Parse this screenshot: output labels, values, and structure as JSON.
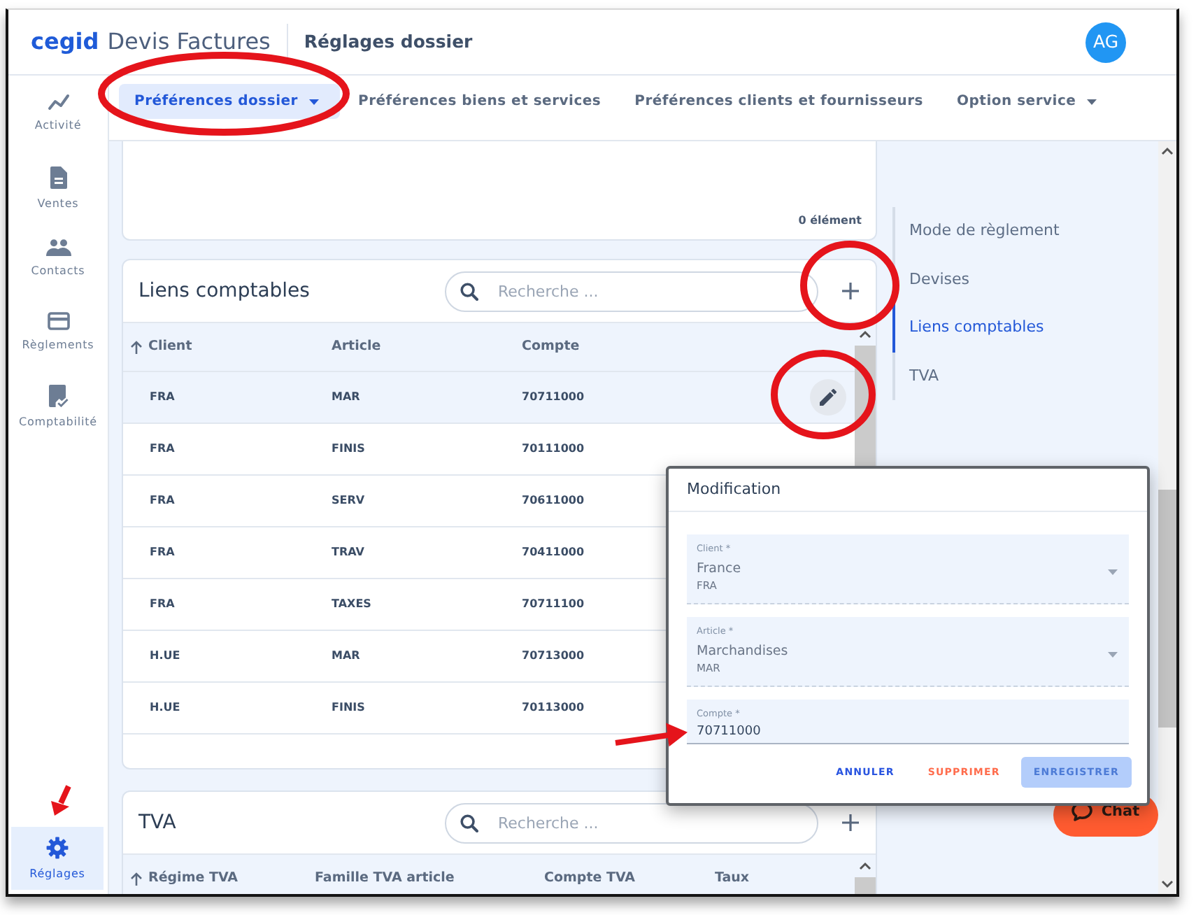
{
  "header": {
    "brand": "cegid",
    "product": "Devis Factures",
    "page_title": "Réglages dossier",
    "avatar": "AG"
  },
  "sidebar": {
    "items": [
      {
        "label": "Activité",
        "selected": false,
        "arrow": false
      },
      {
        "label": "Ventes",
        "selected": false,
        "arrow": false
      },
      {
        "label": "Contacts",
        "selected": false,
        "arrow": false
      },
      {
        "label": "Règlements",
        "selected": false,
        "arrow": false
      },
      {
        "label": "Comptabilité",
        "selected": false,
        "arrow": false
      }
    ],
    "bottom_items": [
      {
        "label": "Réglages",
        "selected": true,
        "arrow": true
      }
    ]
  },
  "tabs": [
    {
      "label": "Préférences dossier",
      "selected": true,
      "dropdown": true,
      "circled": true
    },
    {
      "label": "Préférences biens et services",
      "selected": false,
      "dropdown": false,
      "circled": false
    },
    {
      "label": "Préférences clients et fournisseurs",
      "selected": false,
      "dropdown": false,
      "circled": false
    },
    {
      "label": "Option service",
      "selected": false,
      "dropdown": true,
      "circled": false
    }
  ],
  "top_card": {
    "count": "0 élément"
  },
  "sections": [
    {
      "title": "Liens comptables",
      "search": {
        "placeholder": "Recherche ..."
      },
      "add_button": {
        "circled": true
      },
      "edit_button": {
        "circled": true
      },
      "columns": [
        {
          "label": "Client",
          "sorted": true
        },
        {
          "label": "Article",
          "sorted": false
        },
        {
          "label": "Compte",
          "sorted": false
        }
      ],
      "rows": [
        {
          "cells": [
            "FRA",
            "MAR",
            "70711000"
          ],
          "hovered": true
        },
        {
          "cells": [
            "FRA",
            "FINIS",
            "70111000"
          ],
          "hovered": false
        },
        {
          "cells": [
            "FRA",
            "SERV",
            "70611000"
          ],
          "hovered": false
        },
        {
          "cells": [
            "FRA",
            "TRAV",
            "70411000"
          ],
          "hovered": false
        },
        {
          "cells": [
            "FRA",
            "TAXES",
            "70711100"
          ],
          "hovered": false
        },
        {
          "cells": [
            "H.UE",
            "MAR",
            "70713000"
          ],
          "hovered": false
        },
        {
          "cells": [
            "H.UE",
            "FINIS",
            "70113000"
          ],
          "hovered": false
        }
      ]
    },
    {
      "title": "TVA",
      "search": {
        "placeholder": "Recherche ..."
      },
      "add_button": {
        "circled": false
      },
      "columns": [
        {
          "label": "Régime TVA",
          "sorted": true
        },
        {
          "label": "Famille TVA article",
          "sorted": false
        },
        {
          "label": "Compte TVA",
          "sorted": false
        },
        {
          "label": "Taux",
          "sorted": false
        }
      ]
    }
  ],
  "anchor_nav": [
    {
      "label": "Mode de règlement",
      "selected": false
    },
    {
      "label": "Devises",
      "selected": false
    },
    {
      "label": "Liens comptables",
      "selected": true
    },
    {
      "label": "TVA",
      "selected": false
    }
  ],
  "dialog": {
    "title": "Modification",
    "fields": [
      {
        "kind": "select",
        "label": "Client *",
        "value": "France",
        "detail": "FRA",
        "arrow": false
      },
      {
        "kind": "select",
        "label": "Article *",
        "value": "Marchandises",
        "detail": "MAR",
        "arrow": false
      },
      {
        "kind": "text",
        "label": "Compte *",
        "value": "70711000",
        "arrow": true
      }
    ],
    "buttons": [
      {
        "kind": "cancel",
        "label": "ANNULER",
        "disabled": false
      },
      {
        "kind": "delete",
        "label": "SUPPRIMER",
        "disabled": false
      },
      {
        "kind": "save",
        "label": "ENREGISTRER",
        "disabled": true
      }
    ]
  },
  "chat_button": {
    "label": "Chat"
  }
}
